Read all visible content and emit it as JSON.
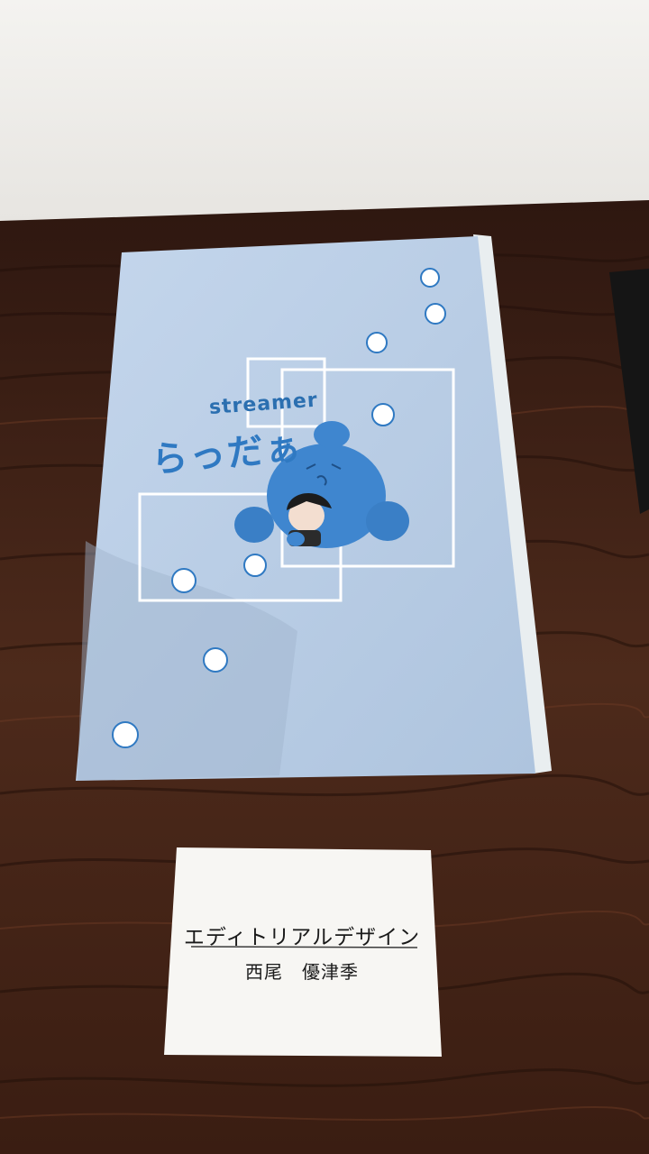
{
  "scene": {
    "description_colors": {
      "wall": "#f2f1ee",
      "table": "#4a2616",
      "booklet": "#bcd0e8",
      "accent_blue": "#2f79c2",
      "card": "#f7f6f3"
    }
  },
  "booklet": {
    "brand_en": "streamer",
    "brand_jp": "らっだぁ"
  },
  "name_card": {
    "title": "エディトリアルデザイン",
    "author": "西尾　優津季"
  }
}
